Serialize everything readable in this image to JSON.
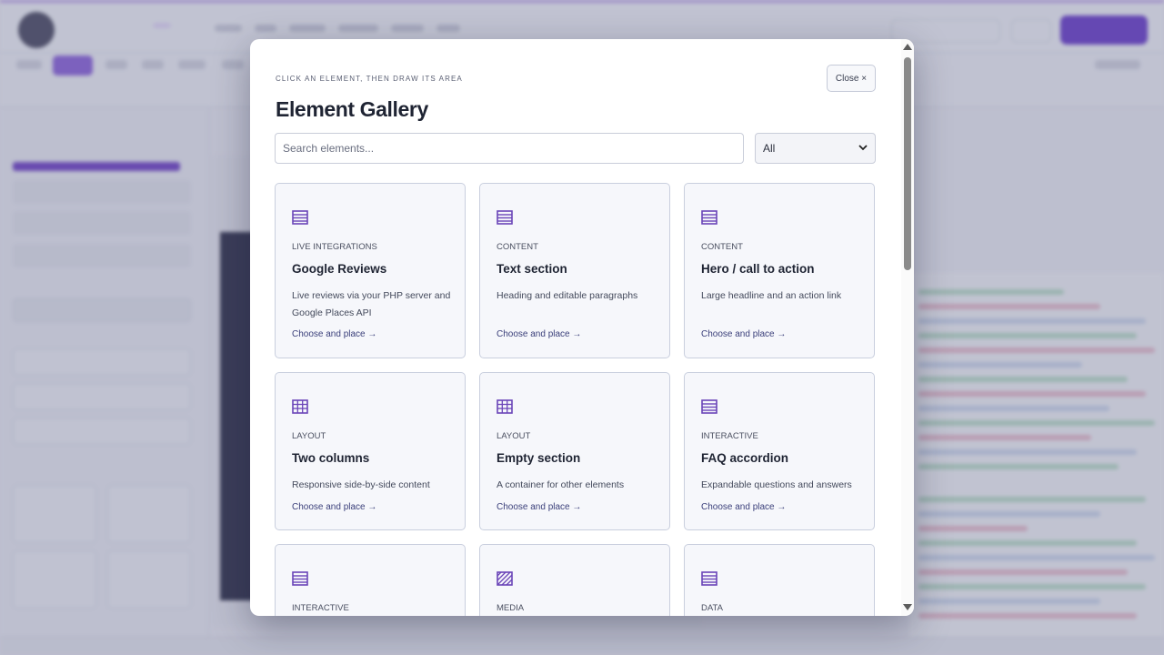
{
  "modal": {
    "eyebrow": "CLICK AN ELEMENT, THEN DRAW ITS AREA",
    "title": "Element Gallery",
    "close_label": "Close ×",
    "search_placeholder": "Search elements...",
    "filter_value": "All",
    "action_label": "Choose and place →"
  },
  "cards": [
    {
      "icon": "list-block-icon",
      "category": "LIVE INTEGRATIONS",
      "name": "Google Reviews",
      "description": "Live reviews via your PHP server and Google Places API"
    },
    {
      "icon": "list-block-icon",
      "category": "CONTENT",
      "name": "Text section",
      "description": "Heading and editable paragraphs"
    },
    {
      "icon": "list-block-icon",
      "category": "CONTENT",
      "name": "Hero / call to action",
      "description": "Large headline and an action link"
    },
    {
      "icon": "grid-icon",
      "category": "LAYOUT",
      "name": "Two columns",
      "description": "Responsive side-by-side content"
    },
    {
      "icon": "grid-icon",
      "category": "LAYOUT",
      "name": "Empty section",
      "description": "A container for other elements"
    },
    {
      "icon": "list-block-icon",
      "category": "INTERACTIVE",
      "name": "FAQ accordion",
      "description": "Expandable questions and answers"
    },
    {
      "icon": "list-block-icon",
      "category": "INTERACTIVE"
    },
    {
      "icon": "hatched-image-icon",
      "category": "MEDIA"
    },
    {
      "icon": "list-block-icon",
      "category": "DATA"
    }
  ],
  "colors": {
    "accent": "#6a3fc9",
    "icon": "#6b45b8",
    "card_border": "#c9cfde",
    "card_bg": "#f6f7fb"
  }
}
